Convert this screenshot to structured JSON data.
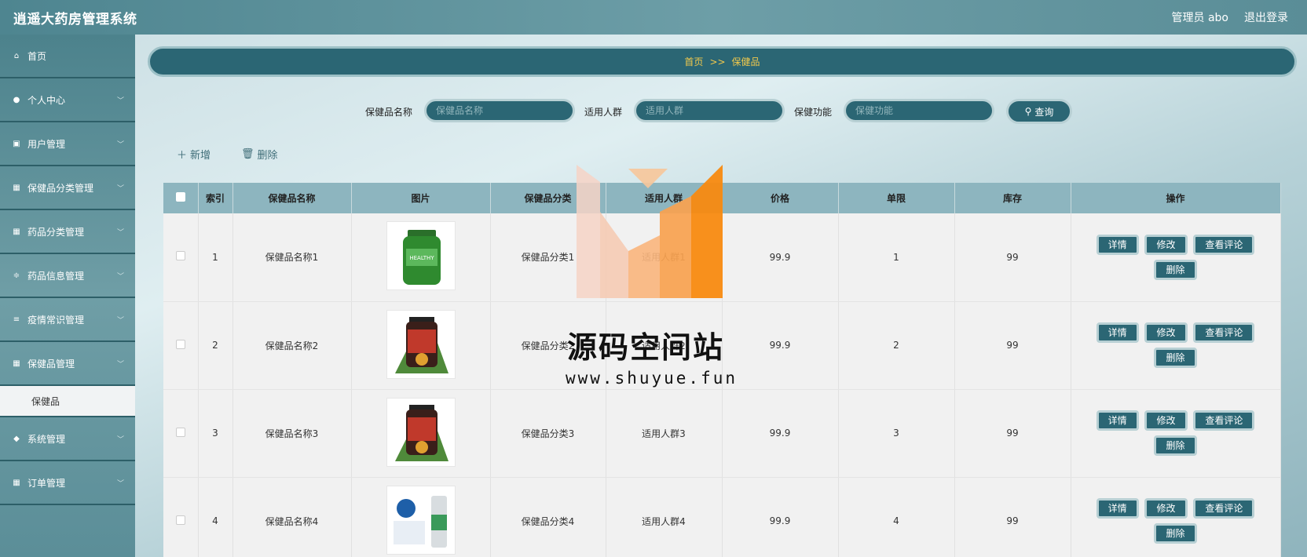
{
  "header": {
    "title": "逍遥大药房管理系统",
    "admin": "管理员 abo",
    "logout": "退出登录"
  },
  "sidebar": {
    "items": [
      {
        "label": "首页",
        "icon": "home-icon"
      },
      {
        "label": "个人中心",
        "icon": "user-icon"
      },
      {
        "label": "用户管理",
        "icon": "chart-icon"
      },
      {
        "label": "保健品分类管理",
        "icon": "grid-icon"
      },
      {
        "label": "药品分类管理",
        "icon": "grid-icon"
      },
      {
        "label": "药品信息管理",
        "icon": "sliders-icon"
      },
      {
        "label": "疫情常识管理",
        "icon": "list-icon"
      },
      {
        "label": "保健品管理",
        "icon": "grid-icon"
      }
    ],
    "sub_item": "保健品",
    "items_after": [
      {
        "label": "系统管理",
        "icon": "pin-icon"
      },
      {
        "label": "订单管理",
        "icon": "grid-icon"
      }
    ]
  },
  "breadcrumb": {
    "home": "首页",
    "separator": ">>",
    "current": "保健品"
  },
  "search": {
    "name_label": "保健品名称",
    "name_placeholder": "保健品名称",
    "crowd_label": "适用人群",
    "crowd_placeholder": "适用人群",
    "func_label": "保健功能",
    "func_placeholder": "保健功能",
    "button": "查询"
  },
  "actions": {
    "add": "新增",
    "delete": "删除"
  },
  "table": {
    "headers": [
      "索引",
      "保健品名称",
      "图片",
      "保健品分类",
      "适用人群",
      "价格",
      "单限",
      "库存",
      "操作"
    ],
    "rows": [
      {
        "index": "1",
        "name": "保健品名称1",
        "category": "保健品分类1",
        "crowd": "适用人群1",
        "price": "99.9",
        "limit": "1",
        "stock": "99"
      },
      {
        "index": "2",
        "name": "保健品名称2",
        "category": "保健品分类2",
        "crowd": "适用人群2",
        "price": "99.9",
        "limit": "2",
        "stock": "99"
      },
      {
        "index": "3",
        "name": "保健品名称3",
        "category": "保健品分类3",
        "crowd": "适用人群3",
        "price": "99.9",
        "limit": "3",
        "stock": "99"
      },
      {
        "index": "4",
        "name": "保健品名称4",
        "category": "保健品分类4",
        "crowd": "适用人群4",
        "price": "99.9",
        "limit": "4",
        "stock": "99"
      }
    ],
    "op_buttons": {
      "detail": "详情",
      "edit": "修改",
      "comments": "查看评论",
      "delete": "删除"
    }
  },
  "watermark": {
    "text": "源码空间站",
    "url": "www.shuyue.fun"
  },
  "colors": {
    "primary": "#2b6674",
    "accent": "#f2c94c",
    "header_bg": "#8db5bf"
  }
}
